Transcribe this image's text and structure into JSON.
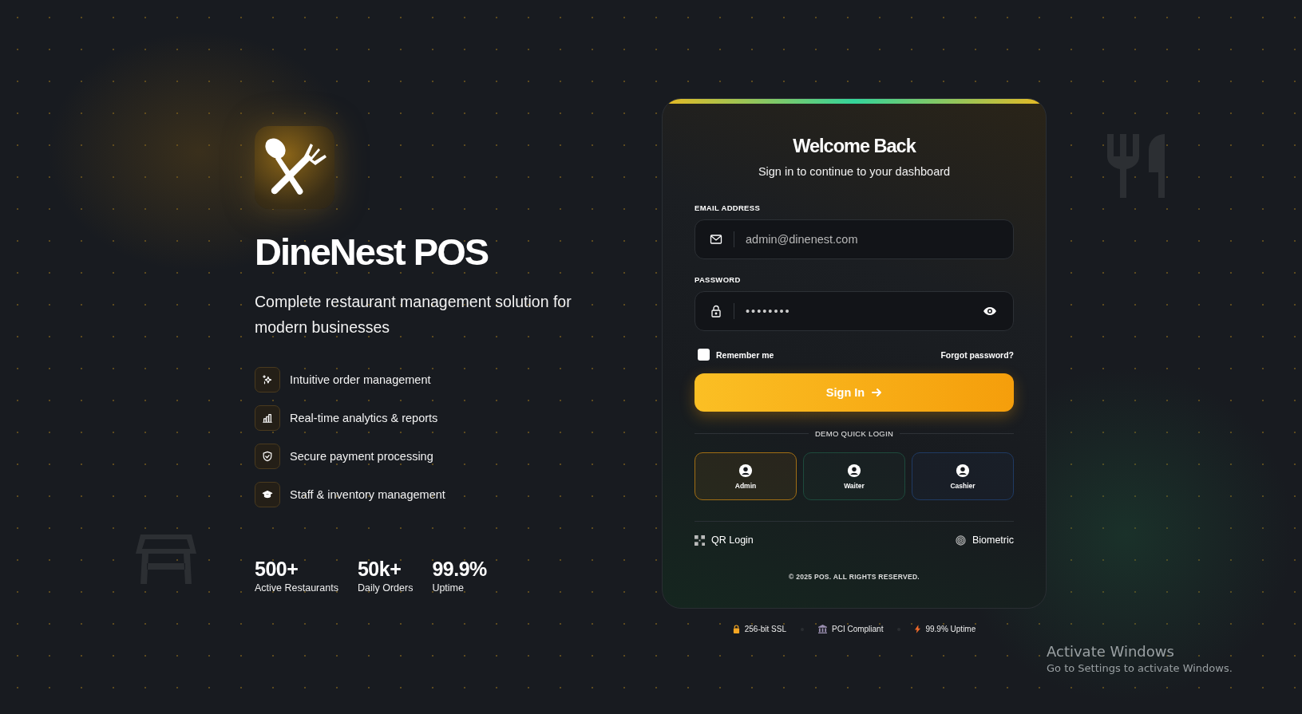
{
  "brand": {
    "title": "DineNest POS",
    "tagline": "Complete restaurant management solution for modern businesses"
  },
  "features": [
    {
      "kind": "sparkle",
      "label": "Intuitive order management"
    },
    {
      "kind": "chart",
      "label": "Real-time analytics & reports"
    },
    {
      "kind": "shield",
      "label": "Secure payment processing"
    },
    {
      "kind": "cap",
      "label": "Staff & inventory management"
    }
  ],
  "stats": [
    {
      "value": "500+",
      "label": "Active Restaurants"
    },
    {
      "value": "50k+",
      "label": "Daily Orders"
    },
    {
      "value": "99.9%",
      "label": "Uptime"
    }
  ],
  "login": {
    "title": "Welcome Back",
    "subtitle": "Sign in to continue to your dashboard",
    "email": {
      "label": "EMAIL ADDRESS",
      "value": "admin@dinenest.com"
    },
    "password": {
      "label": "PASSWORD",
      "value": "••••••••"
    },
    "remember": {
      "label": "Remember me",
      "checked": false
    },
    "forgot": "Forgot password?",
    "submit": "Sign In",
    "divider": "DEMO QUICK LOGIN",
    "demo": [
      {
        "label": "Admin",
        "color": "#a16e14"
      },
      {
        "label": "Waiter",
        "color": "#1d4a3c"
      },
      {
        "label": "Cashier",
        "color": "#1f3a63"
      }
    ],
    "alternatives": [
      {
        "kind": "qr",
        "label": "QR Login"
      },
      {
        "kind": "fingerprint",
        "label": "Biometric"
      }
    ],
    "copyright": "© 2025 POS. ALL RIGHTS RESERVED."
  },
  "badges": [
    {
      "kind": "lock",
      "label": "256-bit SSL"
    },
    {
      "kind": "bank",
      "label": "PCI Compliant"
    },
    {
      "kind": "bolt",
      "label": "99.9% Uptime"
    }
  ],
  "os_notice": {
    "title": "Activate Windows",
    "text": "Go to Settings to activate Windows."
  }
}
